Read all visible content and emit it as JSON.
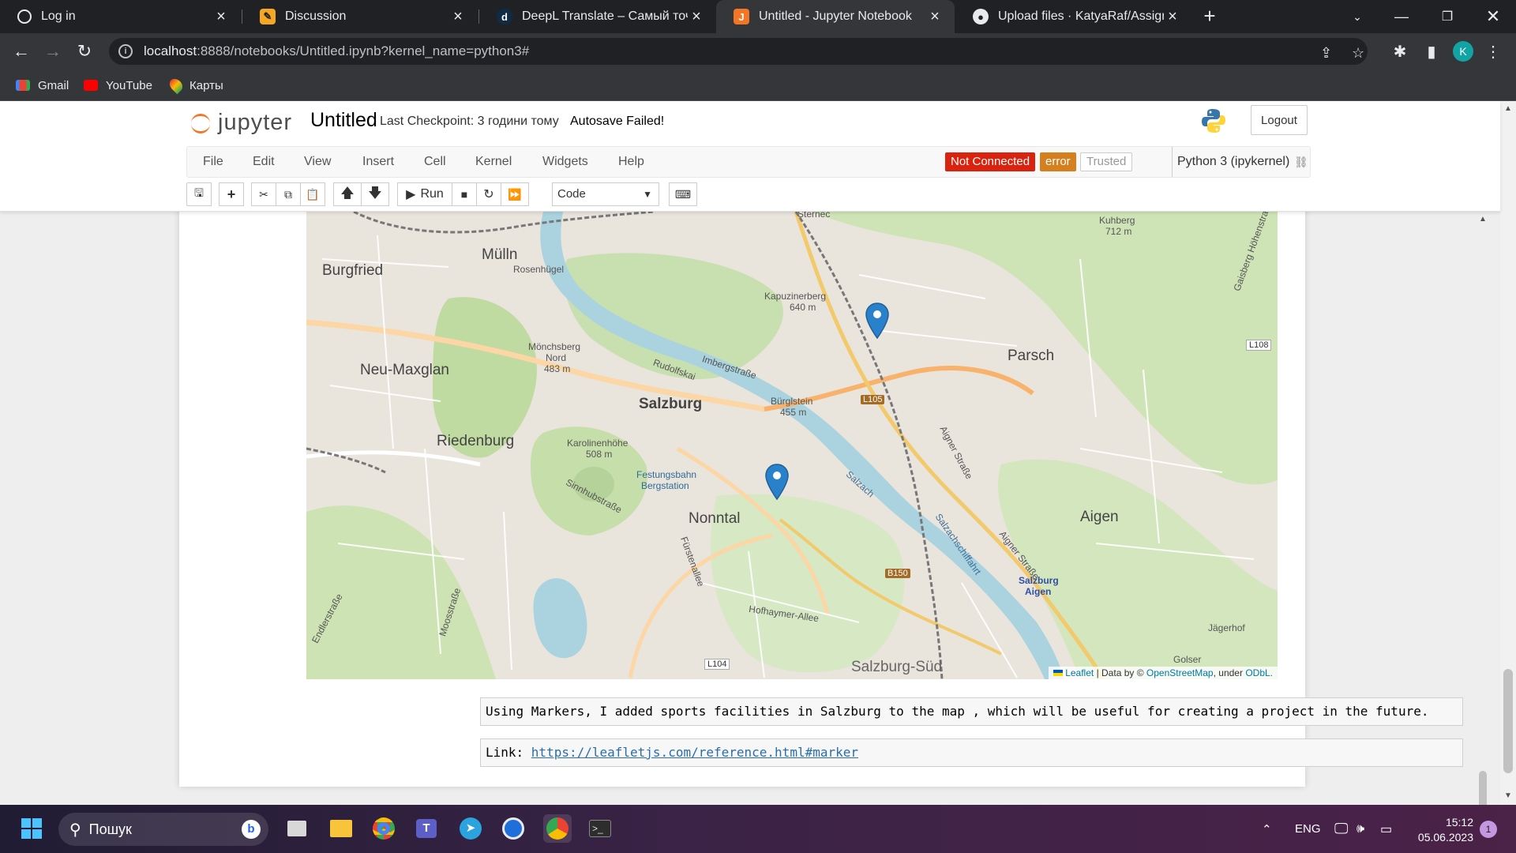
{
  "browser": {
    "tabs": [
      {
        "title": "Log in",
        "icon": "globe-icon"
      },
      {
        "title": "Discussion",
        "icon": "pencil-icon"
      },
      {
        "title": "DeepL Translate – Самый точный",
        "icon": "deepl-icon"
      },
      {
        "title": "Untitled - Jupyter Notebook",
        "icon": "jupyter-icon"
      },
      {
        "title": "Upload files · KatyaRaf/Assignme",
        "icon": "github-icon"
      }
    ],
    "url_host": "localhost",
    "url_rest": ":8888/notebooks/Untitled.ipynb?kernel_name=python3#",
    "profile_initial": "K",
    "bookmarks": [
      {
        "label": "Gmail",
        "icon": "gmail-icon"
      },
      {
        "label": "YouTube",
        "icon": "youtube-icon"
      },
      {
        "label": "Карты",
        "icon": "maps-icon"
      }
    ]
  },
  "jupyter": {
    "logo_text": "jupyter",
    "notebook_name": "Untitled",
    "checkpoint": "Last Checkpoint: 3 години тому",
    "autosave": "Autosave Failed!",
    "logout_label": "Logout",
    "menu": [
      "File",
      "Edit",
      "View",
      "Insert",
      "Cell",
      "Kernel",
      "Widgets",
      "Help"
    ],
    "status": {
      "not_connected": "Not Connected",
      "error": "error",
      "trusted": "Trusted",
      "kernel": "Python 3 (ipykernel)"
    },
    "toolbar": {
      "run_label": "Run",
      "cell_type": "Code",
      "cell_type_options": [
        "Code"
      ]
    },
    "colors": {
      "not_connected_bg": "#d9230f",
      "error_bg": "#d57f1e",
      "accent": "#f37626"
    }
  },
  "map": {
    "places": {
      "mulln": "Mülln",
      "burgfried": "Burgfried",
      "rosenhugel": "Rosenhügel",
      "kapuzinerberg": "Kapuzinerberg",
      "kapuzinerberg_alt": "640 m",
      "monchsberg": "Mönchsberg",
      "monchsberg_2": "Nord",
      "monchsberg_alt": "483 m",
      "neu_maxglan": "Neu-Maxglan",
      "salzburg": "Salzburg",
      "rudolfskai": "Rudolfskai",
      "imbergstrasse": "Imbergstraße",
      "burglstein": "Bürglstein",
      "burglstein_alt": "455 m",
      "riedenburg": "Riedenburg",
      "karolinenhohe": "Karolinenhöhe",
      "karolinenhohe_alt": "508 m",
      "festungsbahn": "Festungsbahn",
      "bergstation": "Bergstation",
      "sinnhubstrasse": "Sinnhubstraße",
      "nonntal": "Nonntal",
      "parsch": "Parsch",
      "kuhberg": "Kuhberg",
      "kuhberg_alt": "712 m",
      "aigen": "Aigen",
      "aigner_strasse": "Aigner Straße",
      "aigner_strasse_2": "Aigner Straße",
      "salzach": "Salzach",
      "salzachschiffahrt": "Salzachschiffahrt",
      "salzburg_aigen": "Salzburg",
      "salzburg_aigen_2": "Aigen",
      "furstenallee": "Fürstenallee",
      "hofhaymer_allee": "Hofhaymer-Allee",
      "moosstrasse": "Moosstraße",
      "endlerstrasse": "Endlerstraße",
      "salzburg_sud": "Salzburg-Süd",
      "jagerhof": "Jägerhof",
      "golser": "Golser",
      "gaisberg": "Gaisberg Höhenstraße",
      "sterneck": "Sternec",
      "road_l105": "L105",
      "road_l108": "L108",
      "road_b150": "B150",
      "road_l104": "L104"
    },
    "markers": [
      {
        "name": "sports-facility-1"
      },
      {
        "name": "sports-facility-2"
      }
    ],
    "attribution": {
      "leaflet": "Leaflet",
      "data_by": " | Data by © ",
      "osm": "OpenStreetMap",
      "under": ", under ",
      "odbl": "ODbL."
    }
  },
  "cells": {
    "markdown_1": "Using Markers, I added sports facilities in Salzburg to the map , which will be useful for creating a project in the future.",
    "markdown_2_prefix": "Link: ",
    "markdown_2_link": "https://leafletjs.com/reference.html#marker"
  },
  "taskbar": {
    "search_placeholder": "Пошук",
    "language": "ENG",
    "time": "15:12",
    "date": "05.06.2023",
    "notification_count": "1"
  }
}
